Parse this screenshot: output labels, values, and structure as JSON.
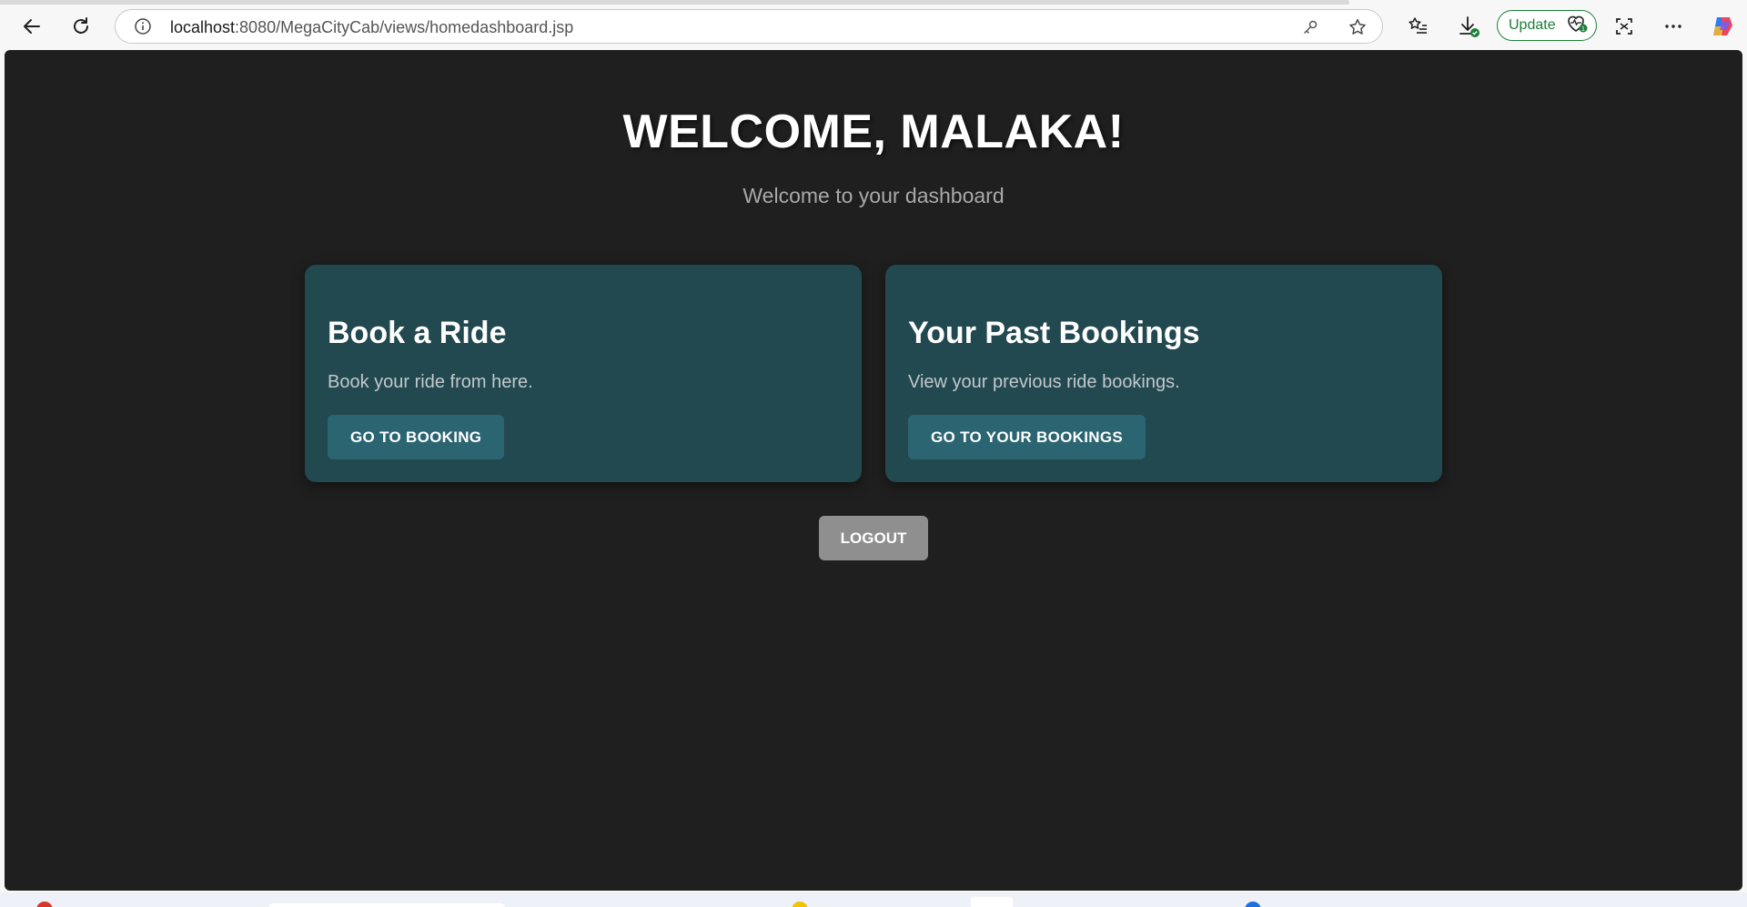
{
  "browser": {
    "url_host": "localhost",
    "url_path": ":8080/MegaCityCab/views/homedashboard.jsp",
    "update_label": "Update",
    "icons": [
      "back-arrow-icon",
      "refresh-icon",
      "site-info-icon",
      "password-key-icon",
      "favorite-star-icon",
      "favorites-list-icon",
      "downloads-icon",
      "heart-badge-icon",
      "screenshot-icon",
      "more-icon",
      "copilot-icon"
    ],
    "accent_color": "#1a7f37"
  },
  "page": {
    "welcome": "WELCOME, MALAKA!",
    "subtitle": "Welcome to your dashboard",
    "background_color": "#1f1f1f",
    "cards": [
      {
        "title": "Book a Ride",
        "description": "Book your ride from here.",
        "button": "GO TO BOOKING"
      },
      {
        "title": "Your Past Bookings",
        "description": "View your previous ride bookings.",
        "button": "GO TO YOUR BOOKINGS"
      }
    ],
    "card_color": "#224850",
    "button_color": "#2b6572",
    "logout": "LOGOUT",
    "logout_color": "#8f8f8f"
  }
}
